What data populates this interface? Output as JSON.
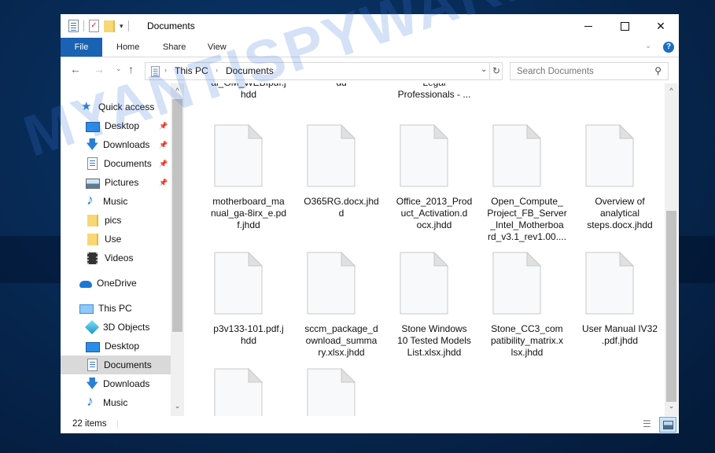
{
  "window": {
    "title": "Documents",
    "controls": {
      "minimize": "minimize",
      "maximize": "maximize",
      "close": "✕"
    }
  },
  "quick_access_toolbar": {
    "icons": [
      "properties-icon",
      "new-folder-check-icon",
      "folder-icon",
      "customize-dropdown-icon"
    ],
    "dropdown_glyph": "▾"
  },
  "ribbon": {
    "tabs": [
      {
        "label": "File",
        "active": true
      },
      {
        "label": "Home"
      },
      {
        "label": "Share"
      },
      {
        "label": "View"
      }
    ],
    "expand_glyph": "⌄",
    "help_glyph": "?"
  },
  "navigation": {
    "back": "←",
    "forward": "→",
    "recent": "⌄",
    "up": "↑",
    "breadcrumb": [
      "This PC",
      "Documents"
    ],
    "crumb_separator": "›",
    "dropdown": "⌄",
    "refresh": "↻",
    "search_placeholder": "Search Documents",
    "search_icon": "⚲"
  },
  "sidebar": {
    "items": [
      {
        "label": "Quick access",
        "icon": "star-icon",
        "level": 0
      },
      {
        "label": "Desktop",
        "icon": "desktop-icon",
        "pinned": true,
        "level": 1
      },
      {
        "label": "Downloads",
        "icon": "download-icon",
        "pinned": true,
        "level": 1
      },
      {
        "label": "Documents",
        "icon": "document-icon",
        "pinned": true,
        "level": 1
      },
      {
        "label": "Pictures",
        "icon": "pictures-icon",
        "pinned": true,
        "level": 1
      },
      {
        "label": "Music",
        "icon": "music-icon",
        "level": 1
      },
      {
        "label": "pics",
        "icon": "folder-icon",
        "level": 1
      },
      {
        "label": "Use",
        "icon": "folder-icon",
        "level": 1
      },
      {
        "label": "Videos",
        "icon": "videos-icon",
        "level": 1
      },
      {
        "label": "OneDrive",
        "icon": "onedrive-icon",
        "level": 0
      },
      {
        "label": "This PC",
        "icon": "this-pc-icon",
        "level": 0
      },
      {
        "label": "3D Objects",
        "icon": "3d-objects-icon",
        "level": 1
      },
      {
        "label": "Desktop",
        "icon": "desktop-icon",
        "level": 1
      },
      {
        "label": "Documents",
        "icon": "document-icon",
        "level": 1,
        "selected": true
      },
      {
        "label": "Downloads",
        "icon": "download-icon",
        "level": 1
      },
      {
        "label": "Music",
        "icon": "music-icon",
        "level": 1
      }
    ],
    "pin_glyph": "📌"
  },
  "files": {
    "partial_row": [
      {
        "line1": "al_GM_WEBIpdf.j",
        "line2": "hdd"
      },
      {
        "line1": "dd",
        "line2": ""
      },
      {
        "line1": "Legal",
        "line2": "Professionals - ..."
      }
    ],
    "rows": [
      [
        {
          "name": "motherboard_manual_ga-8irx_e.pdf.jhdd",
          "lines": [
            "motherboard_ma",
            "nual_ga-8irx_e.pd",
            "f.jhdd"
          ]
        },
        {
          "name": "O365RG.docx.jhdd",
          "lines": [
            "O365RG.docx.jhd",
            "d"
          ]
        },
        {
          "name": "Office_2013_Product_Activation.docx.jhdd",
          "lines": [
            "Office_2013_Prod",
            "uct_Activation.d",
            "ocx.jhdd"
          ]
        },
        {
          "name": "Open_Compute_Project_FB_Server_Intel_Motherboard_v3.1_rev1.00....",
          "lines": [
            "Open_Compute_",
            "Project_FB_Server",
            "_Intel_Motherboa",
            "rd_v3.1_rev1.00...."
          ]
        },
        {
          "name": "Overview of analytical steps.docx.jhdd",
          "lines": [
            "Overview of",
            "analytical",
            "steps.docx.jhdd"
          ]
        }
      ],
      [
        {
          "name": "p3v133-101.pdf.jhdd",
          "lines": [
            "p3v133-101.pdf.j",
            "hdd"
          ]
        },
        {
          "name": "sccm_package_download_summary.xlsx.jhdd",
          "lines": [
            "sccm_package_d",
            "ownload_summa",
            "ry.xlsx.jhdd"
          ]
        },
        {
          "name": "Stone Windows 10 Tested Models List.xlsx.jhdd",
          "lines": [
            "Stone Windows",
            "10 Tested Models",
            "List.xlsx.jhdd"
          ]
        },
        {
          "name": "Stone_CC3_compatibility_matrix.xlsx.jhdd",
          "lines": [
            "Stone_CC3_com",
            "patibility_matrix.x",
            "lsx.jhdd"
          ]
        },
        {
          "name": "User Manual IV32.pdf.jhdd",
          "lines": [
            "User Manual IV32",
            ".pdf.jhdd"
          ]
        }
      ],
      [
        {
          "name": "",
          "lines": []
        },
        {
          "name": "",
          "lines": []
        }
      ]
    ]
  },
  "status_bar": {
    "item_count": "22 items"
  },
  "scrollbars": {
    "up_glyph": "^",
    "down_glyph": "⌄"
  },
  "watermark": "MYANTISPYWARE.COM",
  "colors": {
    "accent": "#1a62b2",
    "selected_bg": "#d9d9d9",
    "desktop_bg": "#072a55"
  }
}
